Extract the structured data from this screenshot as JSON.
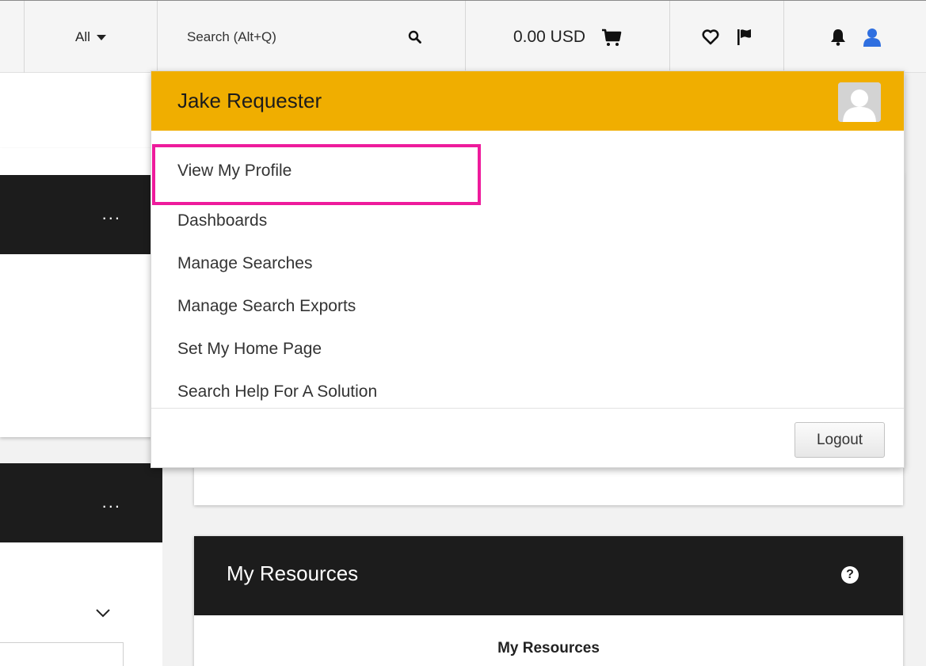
{
  "header": {
    "scope_label": "All",
    "search_placeholder": "Search (Alt+Q)",
    "cart_total": "0.00 USD",
    "icons": [
      "caret-down-icon",
      "search-icon",
      "cart-icon",
      "heart-icon",
      "flag-icon",
      "bell-icon",
      "user-icon"
    ]
  },
  "dropdown": {
    "user_name": "Jake Requester",
    "menu": [
      "View My Profile",
      "Dashboards",
      "Manage Searches",
      "Manage Search Exports",
      "Set My Home Page",
      "Search Help For A Solution"
    ],
    "logout_label": "Logout"
  },
  "left_panels": {
    "more_label": "...",
    "more_label_2": "..."
  },
  "resources": {
    "title": "My Resources",
    "subtitle": "My Resources",
    "help_symbol": "?"
  },
  "colors": {
    "dropdown_header": "#f0ae00",
    "highlight_border": "#ee1b9c",
    "dark_bar": "#1c1c1c",
    "user_icon": "#2f6fe0"
  }
}
